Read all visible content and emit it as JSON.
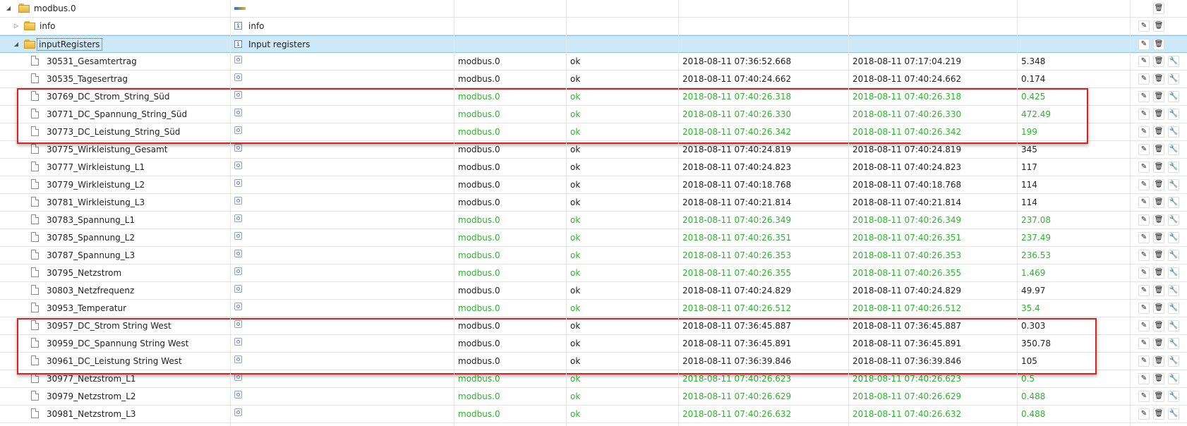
{
  "colors": {
    "ok": "#2cb52c",
    "highlight": "#e01f1f",
    "selected_row": "#cde8f6"
  },
  "icons": {
    "folder": "folder-icon",
    "file": "file-icon",
    "info": "info-icon",
    "state": "state-icon",
    "adapter_logo": "modbus-logo-icon",
    "edit": "pencil-icon",
    "delete": "trash-icon",
    "settings": "wrench-icon",
    "expanded": "expand-toggle-icon",
    "collapsed": "collapse-toggle-icon"
  },
  "tree": {
    "root": {
      "name": "modbus.0"
    },
    "info": {
      "name": "info",
      "desc": "info"
    },
    "inputRegisters": {
      "name": "inputRegisters",
      "desc": "Input registers"
    },
    "states": [
      {
        "name": "30531_Gesamtertrag",
        "adapter": "modbus.0",
        "status": "ok",
        "ts": "2018-08-11 07:36:52.668",
        "lc": "2018-08-11 07:17:04.219",
        "val": "5.348",
        "green": false
      },
      {
        "name": "30535_Tagesertrag",
        "adapter": "modbus.0",
        "status": "ok",
        "ts": "2018-08-11 07:40:24.662",
        "lc": "2018-08-11 07:40:24.662",
        "val": "0.174",
        "green": false
      },
      {
        "name": "30769_DC_Strom_String_Süd",
        "adapter": "modbus.0",
        "status": "ok",
        "ts": "2018-08-11 07:40:26.318",
        "lc": "2018-08-11 07:40:26.318",
        "val": "0.425",
        "green": true
      },
      {
        "name": "30771_DC_Spannung_String_Süd",
        "adapter": "modbus.0",
        "status": "ok",
        "ts": "2018-08-11 07:40:26.330",
        "lc": "2018-08-11 07:40:26.330",
        "val": "472.49",
        "green": true
      },
      {
        "name": "30773_DC_Leistung_String_Süd",
        "adapter": "modbus.0",
        "status": "ok",
        "ts": "2018-08-11 07:40:26.342",
        "lc": "2018-08-11 07:40:26.342",
        "val": "199",
        "green": true
      },
      {
        "name": "30775_Wirkleistung_Gesamt",
        "adapter": "modbus.0",
        "status": "ok",
        "ts": "2018-08-11 07:40:24.819",
        "lc": "2018-08-11 07:40:24.819",
        "val": "345",
        "green": false
      },
      {
        "name": "30777_Wirkleistung_L1",
        "adapter": "modbus.0",
        "status": "ok",
        "ts": "2018-08-11 07:40:24.823",
        "lc": "2018-08-11 07:40:24.823",
        "val": "117",
        "green": false
      },
      {
        "name": "30779_Wirkleistung_L2",
        "adapter": "modbus.0",
        "status": "ok",
        "ts": "2018-08-11 07:40:18.768",
        "lc": "2018-08-11 07:40:18.768",
        "val": "114",
        "green": false
      },
      {
        "name": "30781_Wirkleistung_L3",
        "adapter": "modbus.0",
        "status": "ok",
        "ts": "2018-08-11 07:40:21.814",
        "lc": "2018-08-11 07:40:21.814",
        "val": "114",
        "green": false
      },
      {
        "name": "30783_Spannung_L1",
        "adapter": "modbus.0",
        "status": "ok",
        "ts": "2018-08-11 07:40:26.349",
        "lc": "2018-08-11 07:40:26.349",
        "val": "237.08",
        "green": true
      },
      {
        "name": "30785_Spannung_L2",
        "adapter": "modbus.0",
        "status": "ok",
        "ts": "2018-08-11 07:40:26.351",
        "lc": "2018-08-11 07:40:26.351",
        "val": "237.49",
        "green": true
      },
      {
        "name": "30787_Spannung_L3",
        "adapter": "modbus.0",
        "status": "ok",
        "ts": "2018-08-11 07:40:26.353",
        "lc": "2018-08-11 07:40:26.353",
        "val": "236.53",
        "green": true
      },
      {
        "name": "30795_Netzstrom",
        "adapter": "modbus.0",
        "status": "ok",
        "ts": "2018-08-11 07:40:26.355",
        "lc": "2018-08-11 07:40:26.355",
        "val": "1.469",
        "green": true
      },
      {
        "name": "30803_Netzfrequenz",
        "adapter": "modbus.0",
        "status": "ok",
        "ts": "2018-08-11 07:40:24.829",
        "lc": "2018-08-11 07:40:24.829",
        "val": "49.97",
        "green": false
      },
      {
        "name": "30953_Temperatur",
        "adapter": "modbus.0",
        "status": "ok",
        "ts": "2018-08-11 07:40:26.512",
        "lc": "2018-08-11 07:40:26.512",
        "val": "35.4",
        "green": true
      },
      {
        "name": "30957_DC_Strom String West",
        "adapter": "modbus.0",
        "status": "ok",
        "ts": "2018-08-11 07:36:45.887",
        "lc": "2018-08-11 07:36:45.887",
        "val": "0.303",
        "green": false
      },
      {
        "name": "30959_DC_Spannung String West",
        "adapter": "modbus.0",
        "status": "ok",
        "ts": "2018-08-11 07:36:45.891",
        "lc": "2018-08-11 07:36:45.891",
        "val": "350.78",
        "green": false
      },
      {
        "name": "30961_DC_Leistung String West",
        "adapter": "modbus.0",
        "status": "ok",
        "ts": "2018-08-11 07:36:39.846",
        "lc": "2018-08-11 07:36:39.846",
        "val": "105",
        "green": false
      },
      {
        "name": "30977_Netzstrom_L1",
        "adapter": "modbus.0",
        "status": "ok",
        "ts": "2018-08-11 07:40:26.623",
        "lc": "2018-08-11 07:40:26.623",
        "val": "0.5",
        "green": true
      },
      {
        "name": "30979_Netzstrom_L2",
        "adapter": "modbus.0",
        "status": "ok",
        "ts": "2018-08-11 07:40:26.629",
        "lc": "2018-08-11 07:40:26.629",
        "val": "0.488",
        "green": true
      },
      {
        "name": "30981_Netzstrom_L3",
        "adapter": "modbus.0",
        "status": "ok",
        "ts": "2018-08-11 07:40:26.632",
        "lc": "2018-08-11 07:40:26.632",
        "val": "0.488",
        "green": true
      }
    ]
  }
}
